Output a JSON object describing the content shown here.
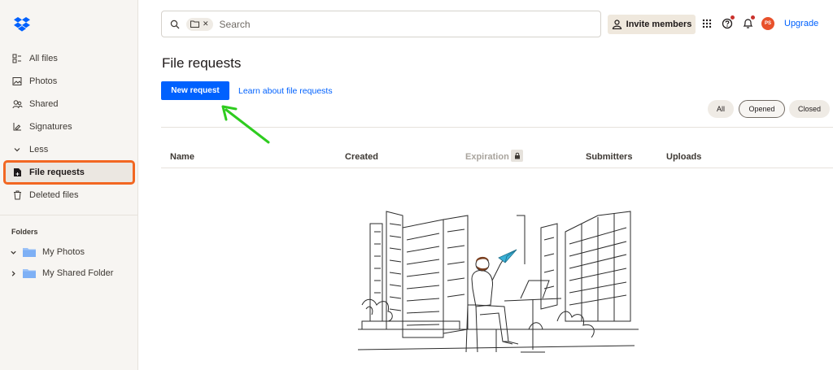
{
  "sidebar": {
    "items": [
      {
        "label": "All files",
        "icon": "all-files-icon"
      },
      {
        "label": "Photos",
        "icon": "photos-icon"
      },
      {
        "label": "Shared",
        "icon": "shared-icon"
      },
      {
        "label": "Signatures",
        "icon": "signatures-icon"
      },
      {
        "label": "Less",
        "icon": "chevron-down-icon"
      },
      {
        "label": "File requests",
        "icon": "file-request-icon",
        "active": true
      },
      {
        "label": "Deleted files",
        "icon": "trash-icon"
      }
    ],
    "folders_label": "Folders",
    "folders": [
      {
        "label": "My Photos",
        "expanded": true
      },
      {
        "label": "My Shared Folder",
        "expanded": false
      }
    ]
  },
  "topbar": {
    "search_placeholder": "Search",
    "invite_label": "Invite members",
    "avatar_initials": "PS",
    "upgrade_label": "Upgrade"
  },
  "main": {
    "title": "File requests",
    "new_request_label": "New request",
    "learn_label": "Learn about file requests",
    "filters": [
      {
        "label": "All",
        "selected": false
      },
      {
        "label": "Opened",
        "selected": true
      },
      {
        "label": "Closed",
        "selected": false
      }
    ],
    "columns": [
      "Name",
      "Created",
      "Expiration",
      "Submitters",
      "Uploads"
    ]
  },
  "colors": {
    "accent": "#0061fe",
    "highlight": "#f26722",
    "arrow": "#2ecc1f",
    "avatar": "#e8512b"
  }
}
